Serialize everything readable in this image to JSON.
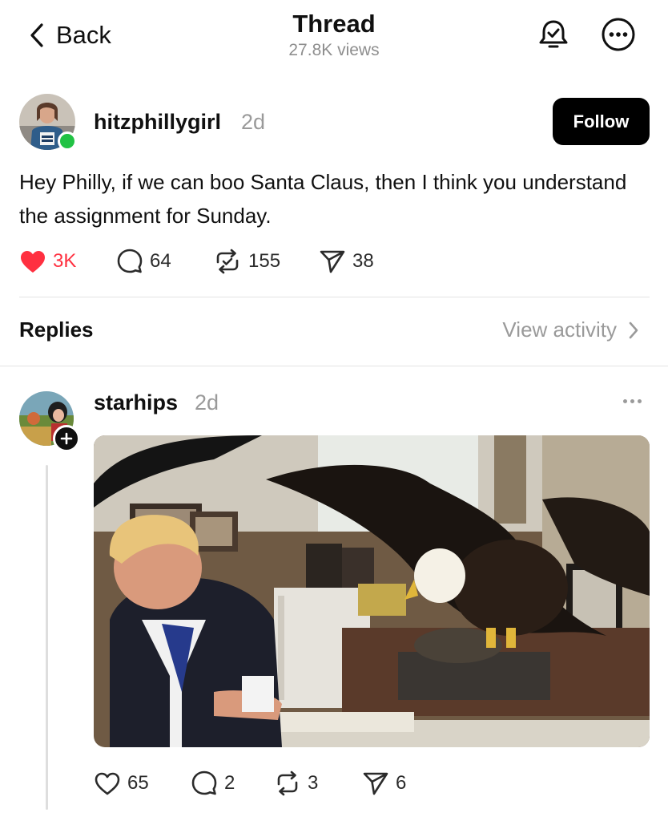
{
  "header": {
    "back_label": "Back",
    "title": "Thread",
    "views": "27.8K views",
    "notify_icon": "bell-check-icon",
    "more_icon": "more-circle-icon"
  },
  "post": {
    "username": "hitzphillygirl",
    "time": "2d",
    "online_status_color": "#21c244",
    "follow_label": "Follow",
    "text": "Hey Philly, if we can boo Santa Claus, then I think you understand the assignment for Sunday.",
    "likes": "3K",
    "replies": "64",
    "reposts": "155",
    "shares": "38",
    "liked": true,
    "like_color": "#ff3040"
  },
  "replies_section": {
    "title": "Replies",
    "view_activity": "View activity"
  },
  "reply": {
    "username": "starhips",
    "time": "2d",
    "likes": "65",
    "replies": "2",
    "reposts": "3",
    "shares": "6",
    "media_icon": "gif-image"
  }
}
